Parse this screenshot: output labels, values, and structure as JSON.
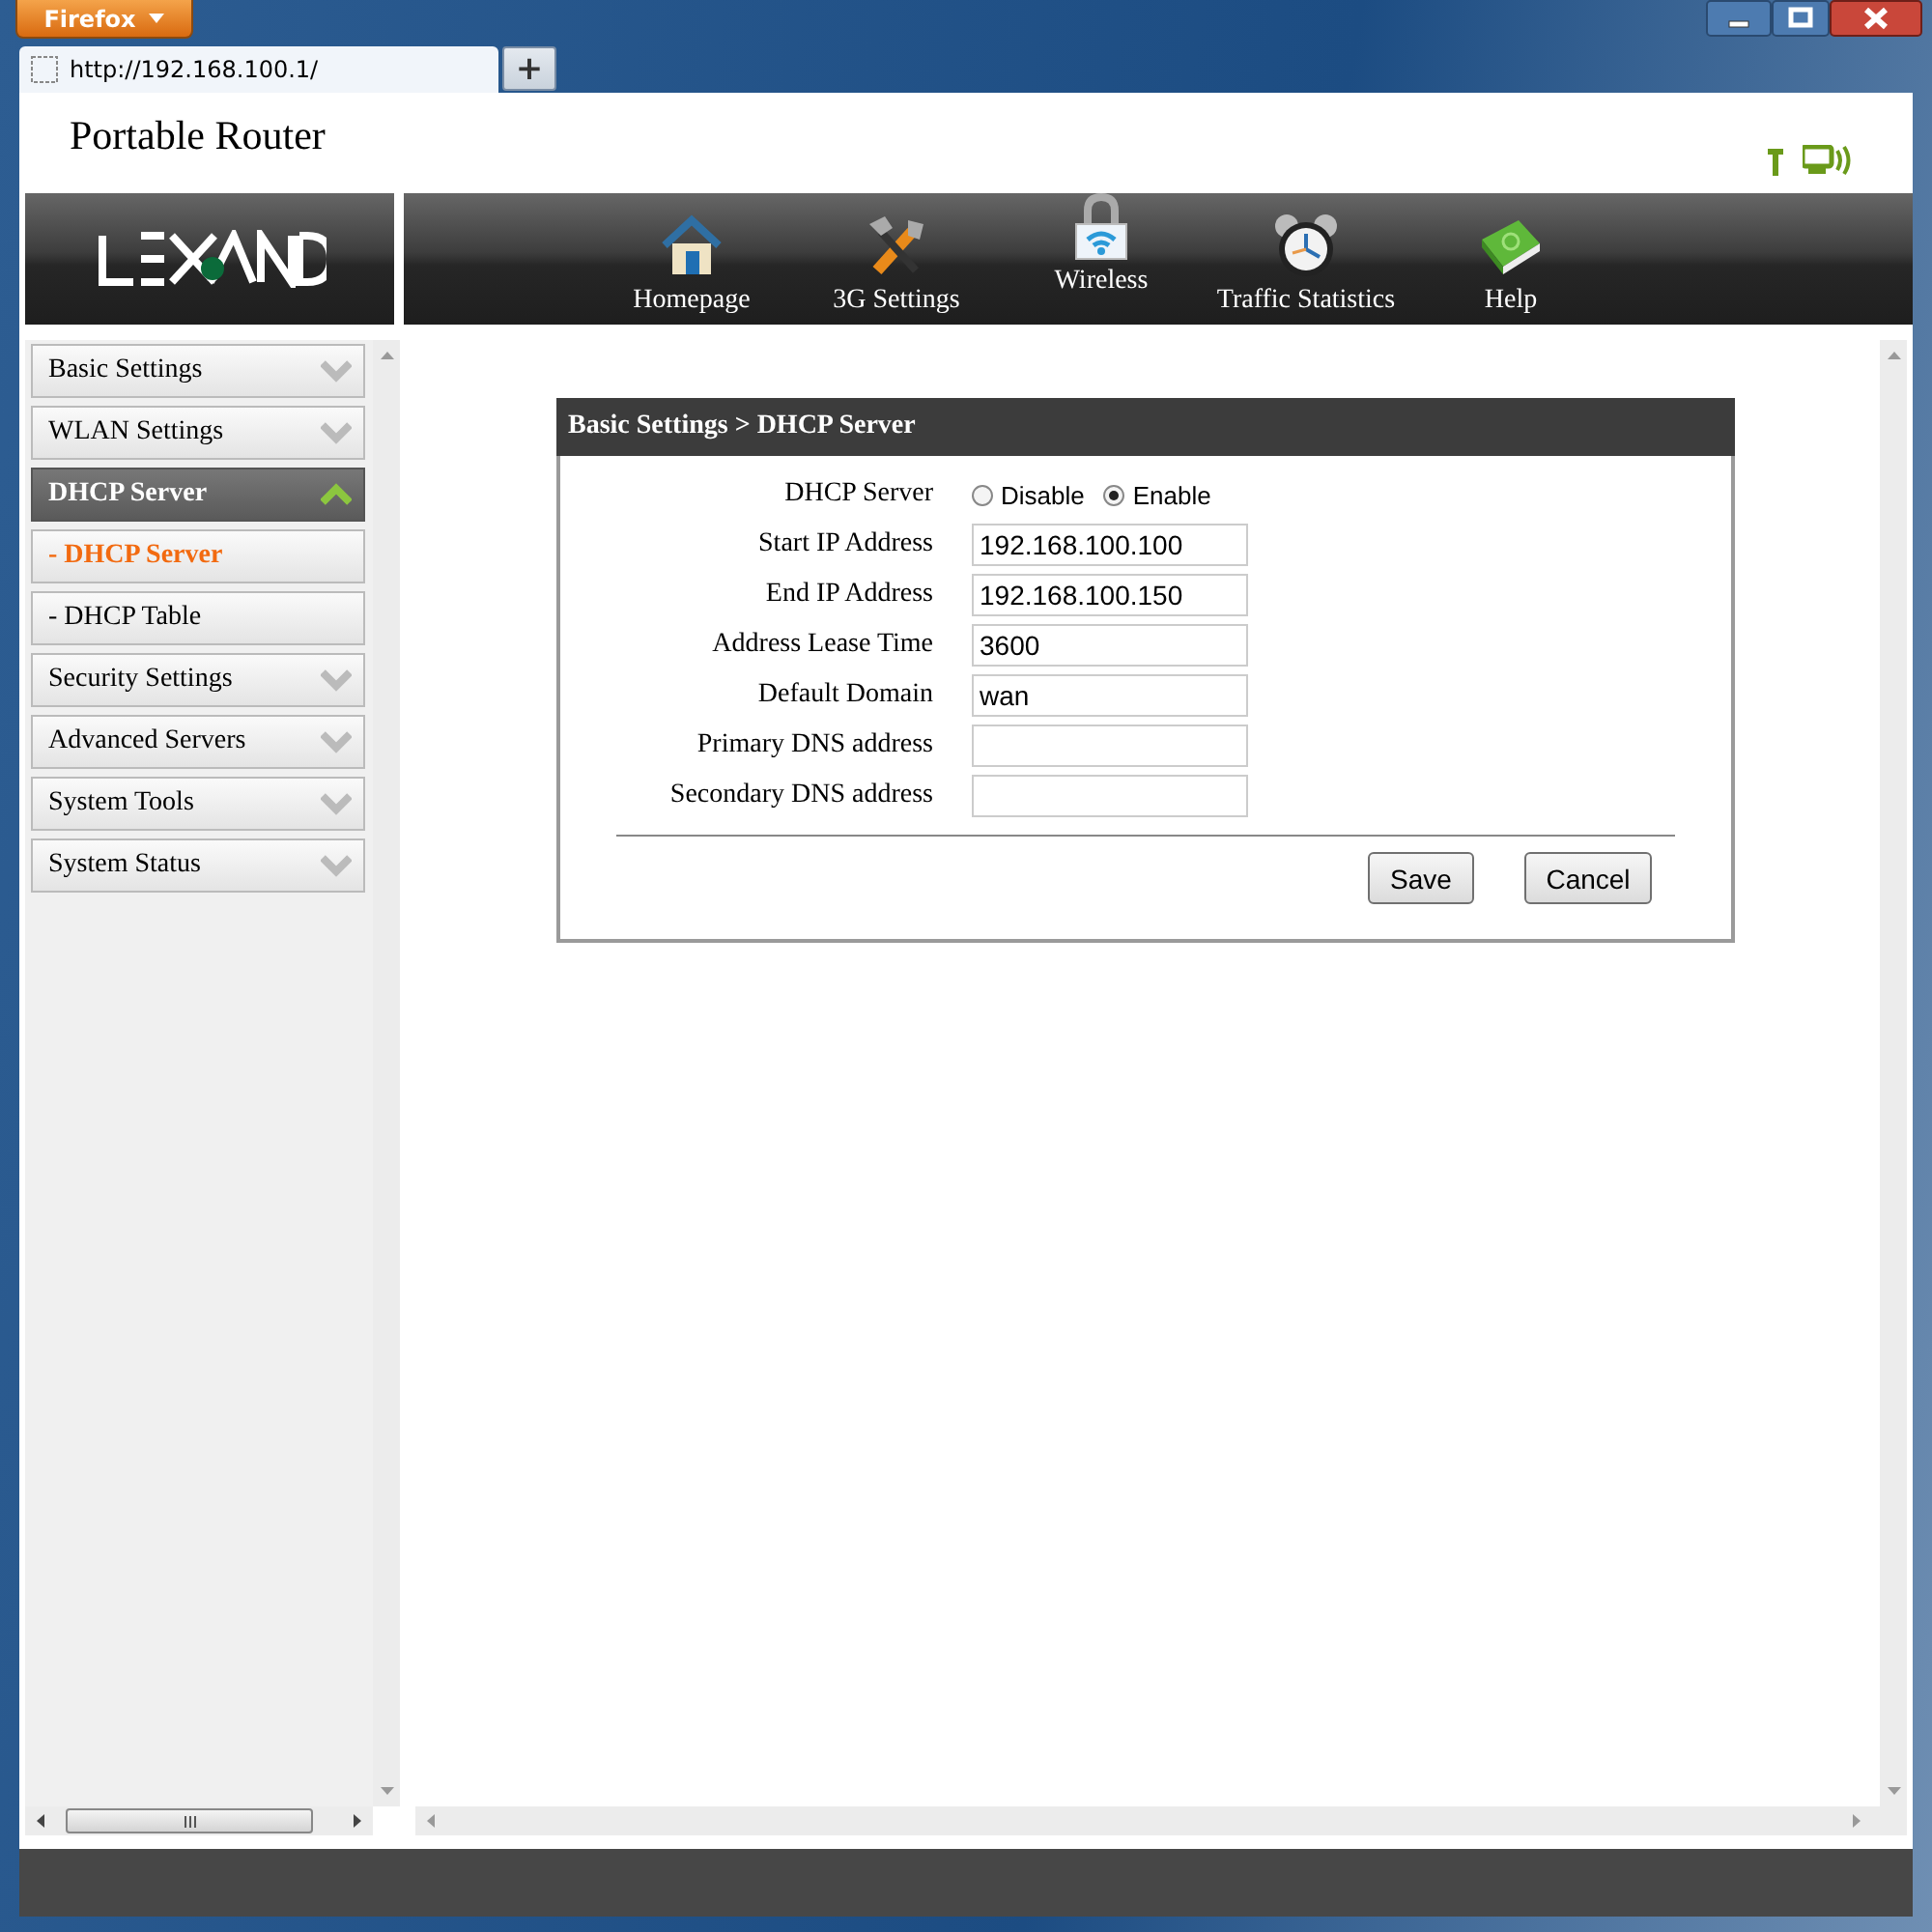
{
  "browser": {
    "menu_button": "Firefox",
    "tab": {
      "url": "http://192.168.100.1/"
    },
    "new_tab_button": "+"
  },
  "page": {
    "title": "Portable Router"
  },
  "nav": [
    {
      "label": "Homepage",
      "kind": "house"
    },
    {
      "label": "3G Settings",
      "kind": "tools"
    },
    {
      "label": "Wireless",
      "kind": "lock"
    },
    {
      "label": "Traffic Statistics",
      "kind": "clock"
    },
    {
      "label": "Help",
      "kind": "book"
    }
  ],
  "sidebar": [
    {
      "label": "Basic Settings",
      "expanded": false
    },
    {
      "label": "WLAN Settings",
      "expanded": false
    },
    {
      "label": "DHCP Server",
      "expanded": true,
      "children": [
        {
          "label": "- DHCP Server",
          "selected": true
        },
        {
          "label": "- DHCP Table",
          "selected": false
        }
      ]
    },
    {
      "label": "Security Settings",
      "expanded": false
    },
    {
      "label": "Advanced Servers",
      "expanded": false
    },
    {
      "label": "System Tools",
      "expanded": false
    },
    {
      "label": "System Status",
      "expanded": false
    }
  ],
  "panel": {
    "title": "Basic Settings > DHCP Server",
    "fields": [
      {
        "label": "DHCP Server",
        "kind": "radio",
        "options": [
          {
            "label": "Disable",
            "selected": false
          },
          {
            "label": "Enable",
            "selected": true
          }
        ]
      },
      {
        "label": "Start IP Address",
        "kind": "text",
        "value": "192.168.100.100"
      },
      {
        "label": "End IP Address",
        "kind": "text",
        "value": "192.168.100.150"
      },
      {
        "label": "Address Lease Time",
        "kind": "text",
        "value": "3600"
      },
      {
        "label": "Default Domain",
        "kind": "text",
        "value": "wan"
      },
      {
        "label": "Primary DNS address",
        "kind": "text"
      },
      {
        "label": "Secondary DNS address",
        "kind": "text"
      }
    ],
    "buttons": [
      "Save",
      "Cancel"
    ]
  }
}
